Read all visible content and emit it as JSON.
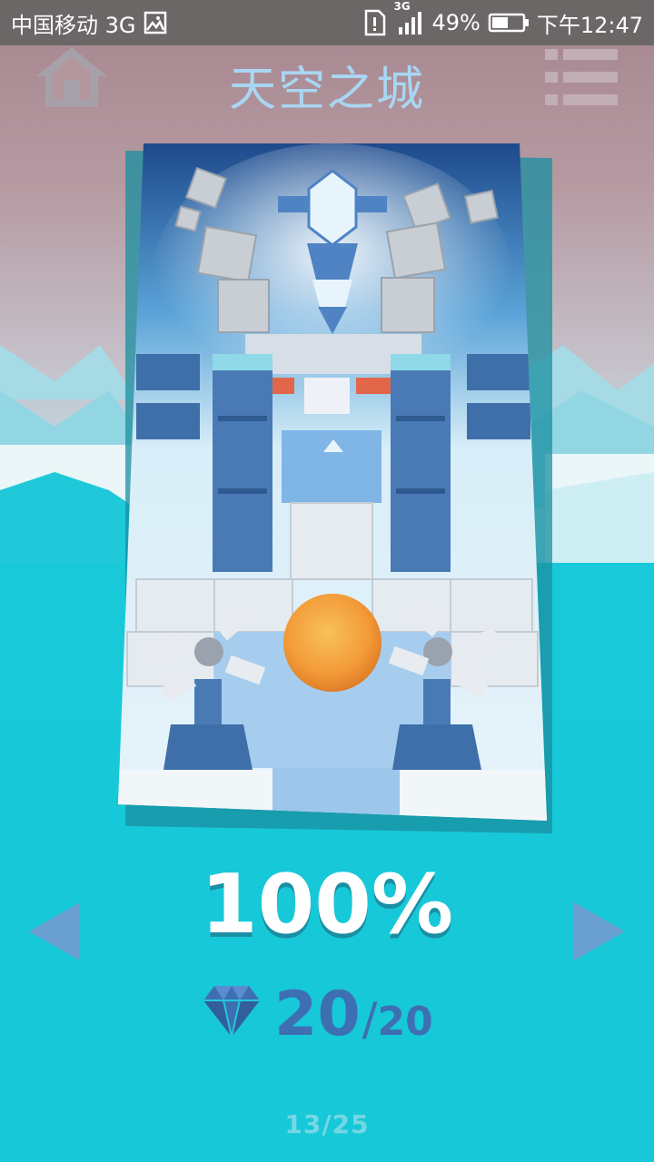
{
  "status_bar": {
    "carrier": "中国移动 3G",
    "network_badge": "3G",
    "battery": "49%",
    "time": "下午12:47",
    "icons": [
      "image-icon",
      "sim-alert-icon",
      "signal-icon",
      "battery-icon"
    ]
  },
  "header": {
    "title": "天空之城",
    "home_icon": "home-icon",
    "menu_icon": "list-menu-icon"
  },
  "level": {
    "progress": "100%",
    "progress_value": 1.0,
    "gems_collected": "20",
    "gems_separator": "/",
    "gems_total": "20",
    "page": "13/25"
  },
  "colors": {
    "sky_top": "#a8888f",
    "ground": "#18cad9",
    "title": "#a9d6f2",
    "gem": "#3e6fb2",
    "ball": "#f39a38"
  }
}
